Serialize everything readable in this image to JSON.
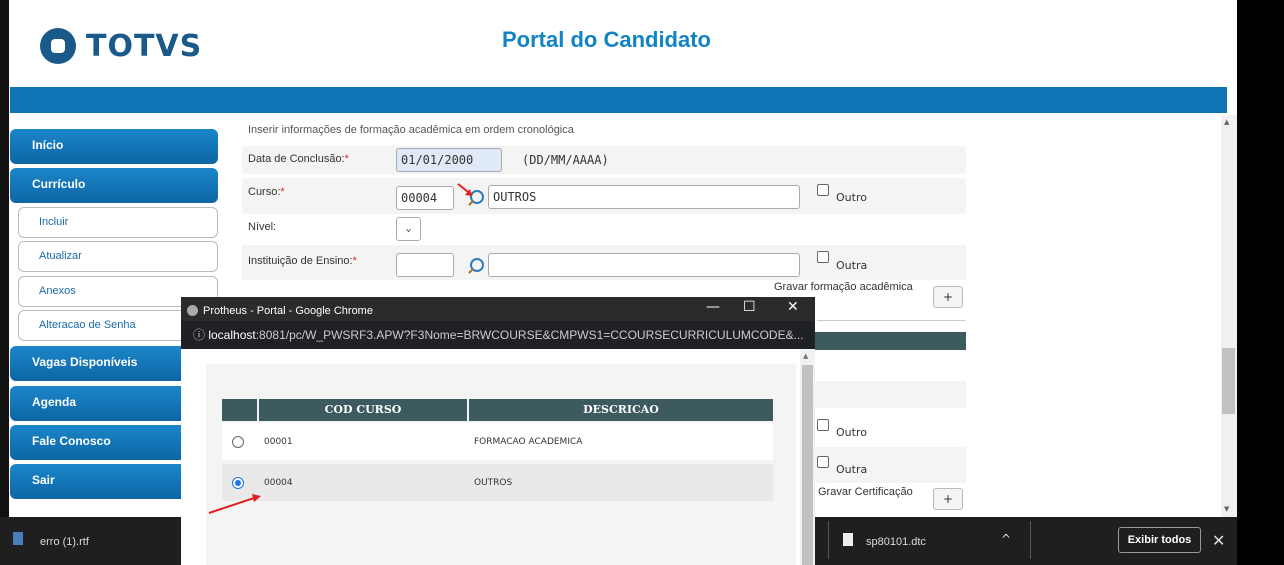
{
  "header": {
    "logo_text": "TOTVS",
    "portal_title": "Portal do Candidato"
  },
  "sidebar": {
    "inicio": "Início",
    "curriculo": "Currículo",
    "sub_items": [
      "Incluir",
      "Atualizar",
      "Anexos",
      "Alteracao de Senha"
    ],
    "vagas": "Vagas Disponíveis",
    "agenda": "Agenda",
    "fale": "Fale Conosco",
    "sair": "Sair"
  },
  "form": {
    "instruction": "Inserir informações de formação acadêmica em ordem cronológica",
    "data_label": "Data de Conclusão:",
    "data_value": "01/01/2000",
    "data_hint": "(DD/MM/AAAA)",
    "curso_label": "Curso:",
    "curso_code": "00004",
    "curso_desc": "OUTROS",
    "outro_label": "Outro",
    "nivel_label": "Nível:",
    "instituicao_label": "Instituição de Ensino:",
    "outra_label": "Outra",
    "gravar_formacao": "Gravar formação acadêmica",
    "plus": "+",
    "outro_label_2": "Outro",
    "outra_label_2": "Outra",
    "gravar_certificacao": "Gravar Certificação",
    "required_mark": "*"
  },
  "popup": {
    "title": "Protheus - Portal - Google Chrome",
    "url_host": "localhost",
    "url_rest": ":8081/pc/W_PWSRF3.APW?F3Nome=BRWCOURSE&CMPWS1=CCOURSECURRICULUMCODE&...",
    "minimize": "—",
    "maximize": "☐",
    "close": "✕",
    "columns": [
      "COD CURSO",
      "DESCRICAO"
    ],
    "rows": [
      {
        "code": "00001",
        "desc": "FORMACAO ACADEMICA",
        "selected": false
      },
      {
        "code": "00004",
        "desc": "OUTROS",
        "selected": true
      }
    ]
  },
  "downloads": {
    "file1": "erro (1).rtf",
    "file2": "sp80101.dtc",
    "show_all": "Exibir todos",
    "close": "✕",
    "caret": "^"
  },
  "colors": {
    "brand_blue": "#0e74b4",
    "title_blue": "#1284c4",
    "table_header": "#3d5a5e",
    "annotation_red": "#e02020"
  }
}
